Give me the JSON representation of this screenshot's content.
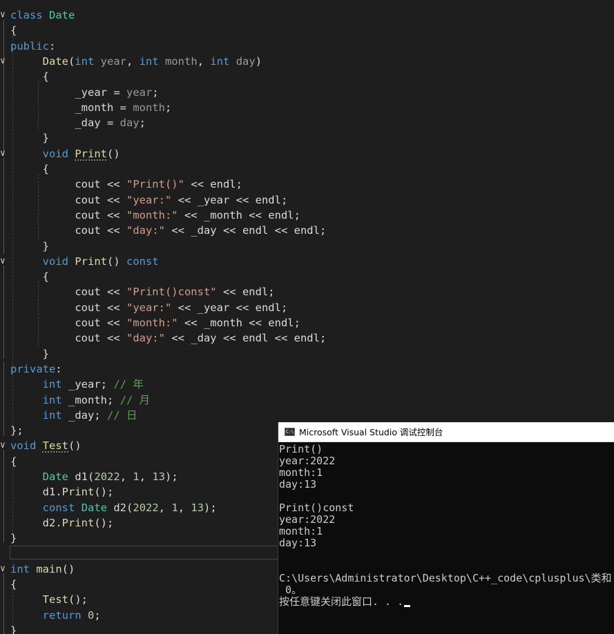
{
  "editor": {
    "lines": [
      {
        "fold": "∨",
        "tokens": [
          {
            "t": "class ",
            "c": "kw"
          },
          {
            "t": "Date",
            "c": "ty"
          }
        ]
      },
      {
        "fold": "",
        "tokens": [
          {
            "t": "{",
            "c": "pl"
          }
        ]
      },
      {
        "fold": "",
        "tokens": [
          {
            "t": "public",
            "c": "kw"
          },
          {
            "t": ":",
            "c": "pl"
          }
        ]
      },
      {
        "fold": "∨",
        "tokens": [
          {
            "t": "     ",
            "c": "pl"
          },
          {
            "t": "Date",
            "c": "fn"
          },
          {
            "t": "(",
            "c": "pl"
          },
          {
            "t": "int",
            "c": "kw"
          },
          {
            "t": " year",
            "c": "pa"
          },
          {
            "t": ", ",
            "c": "pl"
          },
          {
            "t": "int",
            "c": "kw"
          },
          {
            "t": " month",
            "c": "pa"
          },
          {
            "t": ", ",
            "c": "pl"
          },
          {
            "t": "int",
            "c": "kw"
          },
          {
            "t": " day",
            "c": "pa"
          },
          {
            "t": ")",
            "c": "pl"
          }
        ]
      },
      {
        "fold": "",
        "tokens": [
          {
            "t": "     {",
            "c": "pl"
          }
        ]
      },
      {
        "fold": "",
        "tokens": [
          {
            "t": "          ",
            "c": "pl"
          },
          {
            "t": "_year",
            "c": "mv"
          },
          {
            "t": " = ",
            "c": "pl"
          },
          {
            "t": "year",
            "c": "pa"
          },
          {
            "t": ";",
            "c": "pl"
          }
        ]
      },
      {
        "fold": "",
        "tokens": [
          {
            "t": "          ",
            "c": "pl"
          },
          {
            "t": "_month",
            "c": "mv"
          },
          {
            "t": " = ",
            "c": "pl"
          },
          {
            "t": "month",
            "c": "pa"
          },
          {
            "t": ";",
            "c": "pl"
          }
        ]
      },
      {
        "fold": "",
        "tokens": [
          {
            "t": "          ",
            "c": "pl"
          },
          {
            "t": "_day",
            "c": "mv"
          },
          {
            "t": " = ",
            "c": "pl"
          },
          {
            "t": "day",
            "c": "pa"
          },
          {
            "t": ";",
            "c": "pl"
          }
        ]
      },
      {
        "fold": "",
        "tokens": [
          {
            "t": "     }",
            "c": "pl"
          }
        ]
      },
      {
        "fold": "∨",
        "tokens": [
          {
            "t": "     ",
            "c": "pl"
          },
          {
            "t": "void",
            "c": "kw"
          },
          {
            "t": " ",
            "c": "pl"
          },
          {
            "t": "Print",
            "c": "fn squig"
          },
          {
            "t": "()",
            "c": "pl"
          }
        ]
      },
      {
        "fold": "",
        "tokens": [
          {
            "t": "     {",
            "c": "pl"
          }
        ]
      },
      {
        "fold": "",
        "tokens": [
          {
            "t": "          cout << ",
            "c": "pl"
          },
          {
            "t": "\"Print()\"",
            "c": "st"
          },
          {
            "t": " << endl;",
            "c": "pl"
          }
        ]
      },
      {
        "fold": "",
        "tokens": [
          {
            "t": "          cout << ",
            "c": "pl"
          },
          {
            "t": "\"year:\"",
            "c": "st"
          },
          {
            "t": " << ",
            "c": "pl"
          },
          {
            "t": "_year",
            "c": "mv"
          },
          {
            "t": " << endl;",
            "c": "pl"
          }
        ]
      },
      {
        "fold": "",
        "tokens": [
          {
            "t": "          cout << ",
            "c": "pl"
          },
          {
            "t": "\"month:\"",
            "c": "st"
          },
          {
            "t": " << ",
            "c": "pl"
          },
          {
            "t": "_month",
            "c": "mv"
          },
          {
            "t": " << endl;",
            "c": "pl"
          }
        ]
      },
      {
        "fold": "",
        "tokens": [
          {
            "t": "          cout << ",
            "c": "pl"
          },
          {
            "t": "\"day:\"",
            "c": "st"
          },
          {
            "t": " << ",
            "c": "pl"
          },
          {
            "t": "_day",
            "c": "mv"
          },
          {
            "t": " << endl << endl;",
            "c": "pl"
          }
        ]
      },
      {
        "fold": "",
        "tokens": [
          {
            "t": "     }",
            "c": "pl"
          }
        ]
      },
      {
        "fold": "∨",
        "tokens": [
          {
            "t": "     ",
            "c": "pl"
          },
          {
            "t": "void",
            "c": "kw"
          },
          {
            "t": " ",
            "c": "pl"
          },
          {
            "t": "Print",
            "c": "fn"
          },
          {
            "t": "() ",
            "c": "pl"
          },
          {
            "t": "const",
            "c": "kw"
          }
        ]
      },
      {
        "fold": "",
        "tokens": [
          {
            "t": "     {",
            "c": "pl"
          }
        ]
      },
      {
        "fold": "",
        "tokens": [
          {
            "t": "          cout << ",
            "c": "pl"
          },
          {
            "t": "\"Print()const\"",
            "c": "st"
          },
          {
            "t": " << endl;",
            "c": "pl"
          }
        ]
      },
      {
        "fold": "",
        "tokens": [
          {
            "t": "          cout << ",
            "c": "pl"
          },
          {
            "t": "\"year:\"",
            "c": "st"
          },
          {
            "t": " << ",
            "c": "pl"
          },
          {
            "t": "_year",
            "c": "mv"
          },
          {
            "t": " << endl;",
            "c": "pl"
          }
        ]
      },
      {
        "fold": "",
        "tokens": [
          {
            "t": "          cout << ",
            "c": "pl"
          },
          {
            "t": "\"month:\"",
            "c": "st"
          },
          {
            "t": " << ",
            "c": "pl"
          },
          {
            "t": "_month",
            "c": "mv"
          },
          {
            "t": " << endl;",
            "c": "pl"
          }
        ]
      },
      {
        "fold": "",
        "tokens": [
          {
            "t": "          cout << ",
            "c": "pl"
          },
          {
            "t": "\"day:\"",
            "c": "st"
          },
          {
            "t": " << ",
            "c": "pl"
          },
          {
            "t": "_day",
            "c": "mv"
          },
          {
            "t": " << endl << endl;",
            "c": "pl"
          }
        ]
      },
      {
        "fold": "",
        "tokens": [
          {
            "t": "     }",
            "c": "pl"
          }
        ]
      },
      {
        "fold": "",
        "tokens": [
          {
            "t": "private",
            "c": "kw"
          },
          {
            "t": ":",
            "c": "pl"
          }
        ]
      },
      {
        "fold": "",
        "tokens": [
          {
            "t": "     ",
            "c": "pl"
          },
          {
            "t": "int",
            "c": "kw"
          },
          {
            "t": " ",
            "c": "pl"
          },
          {
            "t": "_year",
            "c": "mv"
          },
          {
            "t": "; ",
            "c": "pl"
          },
          {
            "t": "// 年",
            "c": "cm"
          }
        ]
      },
      {
        "fold": "",
        "tokens": [
          {
            "t": "     ",
            "c": "pl"
          },
          {
            "t": "int",
            "c": "kw"
          },
          {
            "t": " ",
            "c": "pl"
          },
          {
            "t": "_month",
            "c": "mv"
          },
          {
            "t": "; ",
            "c": "pl"
          },
          {
            "t": "// 月",
            "c": "cm"
          }
        ]
      },
      {
        "fold": "",
        "tokens": [
          {
            "t": "     ",
            "c": "pl"
          },
          {
            "t": "int",
            "c": "kw"
          },
          {
            "t": " ",
            "c": "pl"
          },
          {
            "t": "_day",
            "c": "mv"
          },
          {
            "t": "; ",
            "c": "pl"
          },
          {
            "t": "// 日",
            "c": "cm"
          }
        ]
      },
      {
        "fold": "",
        "tokens": [
          {
            "t": "};",
            "c": "pl"
          }
        ]
      },
      {
        "fold": "∨",
        "tokens": [
          {
            "t": "void",
            "c": "kw"
          },
          {
            "t": " ",
            "c": "pl"
          },
          {
            "t": "Test",
            "c": "fn squig"
          },
          {
            "t": "()",
            "c": "pl"
          }
        ]
      },
      {
        "fold": "",
        "tokens": [
          {
            "t": "{",
            "c": "pl"
          }
        ]
      },
      {
        "fold": "",
        "tokens": [
          {
            "t": "     ",
            "c": "pl"
          },
          {
            "t": "Date",
            "c": "ty"
          },
          {
            "t": " ",
            "c": "pl"
          },
          {
            "t": "d1",
            "c": "pl"
          },
          {
            "t": "(",
            "c": "pl"
          },
          {
            "t": "2022",
            "c": "nu"
          },
          {
            "t": ", ",
            "c": "pl"
          },
          {
            "t": "1",
            "c": "nu"
          },
          {
            "t": ", ",
            "c": "pl"
          },
          {
            "t": "13",
            "c": "nu"
          },
          {
            "t": ");",
            "c": "pl"
          }
        ]
      },
      {
        "fold": "",
        "tokens": [
          {
            "t": "     d1.",
            "c": "pl"
          },
          {
            "t": "Print",
            "c": "fn"
          },
          {
            "t": "();",
            "c": "pl"
          }
        ]
      },
      {
        "fold": "",
        "tokens": [
          {
            "t": "     ",
            "c": "pl"
          },
          {
            "t": "const",
            "c": "kw"
          },
          {
            "t": " ",
            "c": "pl"
          },
          {
            "t": "Date",
            "c": "ty"
          },
          {
            "t": " d2",
            "c": "pl"
          },
          {
            "t": "(",
            "c": "pl"
          },
          {
            "t": "2022",
            "c": "nu"
          },
          {
            "t": ", ",
            "c": "pl"
          },
          {
            "t": "1",
            "c": "nu"
          },
          {
            "t": ", ",
            "c": "pl"
          },
          {
            "t": "13",
            "c": "nu"
          },
          {
            "t": ");",
            "c": "pl"
          }
        ]
      },
      {
        "fold": "",
        "tokens": [
          {
            "t": "     d2.",
            "c": "pl"
          },
          {
            "t": "Print",
            "c": "fn"
          },
          {
            "t": "();",
            "c": "pl"
          }
        ]
      },
      {
        "fold": "",
        "tokens": [
          {
            "t": "}",
            "c": "pl"
          }
        ]
      },
      {
        "fold": "",
        "tokens": []
      },
      {
        "fold": "∨",
        "tokens": [
          {
            "t": "int",
            "c": "kw"
          },
          {
            "t": " ",
            "c": "pl"
          },
          {
            "t": "main",
            "c": "fn"
          },
          {
            "t": "()",
            "c": "pl"
          }
        ]
      },
      {
        "fold": "",
        "tokens": [
          {
            "t": "{",
            "c": "pl"
          }
        ]
      },
      {
        "fold": "",
        "tokens": [
          {
            "t": "     ",
            "c": "pl"
          },
          {
            "t": "Test",
            "c": "fn"
          },
          {
            "t": "();",
            "c": "pl"
          }
        ]
      },
      {
        "fold": "",
        "tokens": [
          {
            "t": "     ",
            "c": "pl"
          },
          {
            "t": "return",
            "c": "kw"
          },
          {
            "t": " ",
            "c": "pl"
          },
          {
            "t": "0",
            "c": "nu"
          },
          {
            "t": ";",
            "c": "pl"
          }
        ]
      },
      {
        "fold": "",
        "tokens": [
          {
            "t": "}",
            "c": "pl"
          }
        ]
      }
    ]
  },
  "console": {
    "title": "Microsoft Visual Studio 调试控制台",
    "icon_label": "C:\\",
    "icon": "console-app-icon",
    "lines": [
      "Print()",
      "year:2022",
      "month:1",
      "day:13",
      "",
      "Print()const",
      "year:2022",
      "month:1",
      "day:13",
      "",
      "",
      "C:\\Users\\Administrator\\Desktop\\C++_code\\cplusplus\\类和",
      " 0。",
      "按任意键关闭此窗口. . ."
    ]
  },
  "colors": {
    "background": "#1e1e1e",
    "keyword": "#569cd6",
    "type": "#4ec9b0",
    "function": "#dcdcaa",
    "string": "#d69d85",
    "comment": "#57a64a",
    "number": "#b5cea8",
    "console_bg": "#0c0c0c",
    "console_text": "#cccccc"
  }
}
